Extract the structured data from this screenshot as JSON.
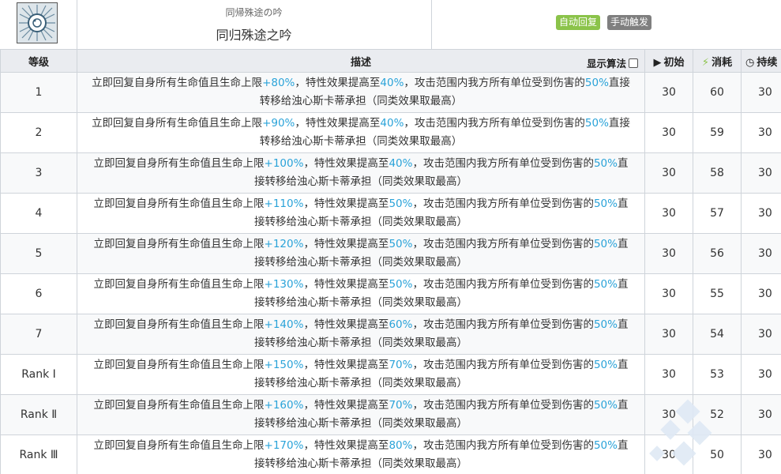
{
  "header": {
    "subname": "同帰殊途の吟",
    "name": "同归殊途之吟",
    "badges": [
      "自动回复",
      "手动触发"
    ]
  },
  "table": {
    "col_level": "等级",
    "col_desc": "描述",
    "show_algo": "显示算法",
    "col_initial": "初始",
    "col_cost": "消耗",
    "col_duration": "持续",
    "rows": [
      {
        "level": "1",
        "heal": "+80%",
        "boost": "40%",
        "pct": "50%",
        "initial": "30",
        "cost": "60",
        "duration": "30",
        "line1a": "立即回复自身所有生命值且生命上限",
        "line1b": "，特性效果提高至",
        "line1c": "，攻击范围内我方所有单位受到伤害的",
        "line1d": "直接",
        "line2": "转移给浊心斯卡蒂承担（同类效果取最高）"
      },
      {
        "level": "2",
        "heal": "+90%",
        "boost": "40%",
        "pct": "50%",
        "initial": "30",
        "cost": "59",
        "duration": "30",
        "line1a": "立即回复自身所有生命值且生命上限",
        "line1b": "，特性效果提高至",
        "line1c": "，攻击范围内我方所有单位受到伤害的",
        "line1d": "直接",
        "line2": "转移给浊心斯卡蒂承担（同类效果取最高）"
      },
      {
        "level": "3",
        "heal": "+100%",
        "boost": "40%",
        "pct": "50%",
        "initial": "30",
        "cost": "58",
        "duration": "30",
        "line1a": "立即回复自身所有生命值且生命上限",
        "line1b": "，特性效果提高至",
        "line1c": "，攻击范围内我方所有单位受到伤害的",
        "line1d": "直",
        "line2": "接转移给浊心斯卡蒂承担（同类效果取最高）"
      },
      {
        "level": "4",
        "heal": "+110%",
        "boost": "50%",
        "pct": "50%",
        "initial": "30",
        "cost": "57",
        "duration": "30",
        "line1a": "立即回复自身所有生命值且生命上限",
        "line1b": "，特性效果提高至",
        "line1c": "，攻击范围内我方所有单位受到伤害的",
        "line1d": "直",
        "line2": "接转移给浊心斯卡蒂承担（同类效果取最高）"
      },
      {
        "level": "5",
        "heal": "+120%",
        "boost": "50%",
        "pct": "50%",
        "initial": "30",
        "cost": "56",
        "duration": "30",
        "line1a": "立即回复自身所有生命值且生命上限",
        "line1b": "，特性效果提高至",
        "line1c": "，攻击范围内我方所有单位受到伤害的",
        "line1d": "直",
        "line2": "接转移给浊心斯卡蒂承担（同类效果取最高）"
      },
      {
        "level": "6",
        "heal": "+130%",
        "boost": "50%",
        "pct": "50%",
        "initial": "30",
        "cost": "55",
        "duration": "30",
        "line1a": "立即回复自身所有生命值且生命上限",
        "line1b": "，特性效果提高至",
        "line1c": "，攻击范围内我方所有单位受到伤害的",
        "line1d": "直",
        "line2": "接转移给浊心斯卡蒂承担（同类效果取最高）"
      },
      {
        "level": "7",
        "heal": "+140%",
        "boost": "60%",
        "pct": "50%",
        "initial": "30",
        "cost": "54",
        "duration": "30",
        "line1a": "立即回复自身所有生命值且生命上限",
        "line1b": "，特性效果提高至",
        "line1c": "，攻击范围内我方所有单位受到伤害的",
        "line1d": "直",
        "line2": "接转移给浊心斯卡蒂承担（同类效果取最高）"
      },
      {
        "level": "Rank Ⅰ",
        "heal": "+150%",
        "boost": "70%",
        "pct": "50%",
        "initial": "30",
        "cost": "53",
        "duration": "30",
        "line1a": "立即回复自身所有生命值且生命上限",
        "line1b": "，特性效果提高至",
        "line1c": "，攻击范围内我方所有单位受到伤害的",
        "line1d": "直",
        "line2": "接转移给浊心斯卡蒂承担（同类效果取最高）"
      },
      {
        "level": "Rank Ⅱ",
        "heal": "+160%",
        "boost": "70%",
        "pct": "50%",
        "initial": "30",
        "cost": "52",
        "duration": "30",
        "line1a": "立即回复自身所有生命值且生命上限",
        "line1b": "，特性效果提高至",
        "line1c": "，攻击范围内我方所有单位受到伤害的",
        "line1d": "直",
        "line2": "接转移给浊心斯卡蒂承担（同类效果取最高）"
      },
      {
        "level": "Rank Ⅲ",
        "heal": "+170%",
        "boost": "80%",
        "pct": "50%",
        "initial": "30",
        "cost": "50",
        "duration": "30",
        "line1a": "立即回复自身所有生命值且生命上限",
        "line1b": "，特性效果提高至",
        "line1c": "，攻击范围内我方所有单位受到伤害的",
        "line1d": "直",
        "line2": "接转移给浊心斯卡蒂承担（同类效果取最高）"
      }
    ]
  },
  "colors": {
    "highlight": "#2aa3d9",
    "header_bg": "#eaecf0",
    "auto_badge": "#8bc34a",
    "manual_badge": "#7f7f7f"
  },
  "icons": {
    "skill": "skill-icon",
    "play": "play-icon",
    "bolt": "lightning-icon",
    "clock": "clock-icon"
  }
}
